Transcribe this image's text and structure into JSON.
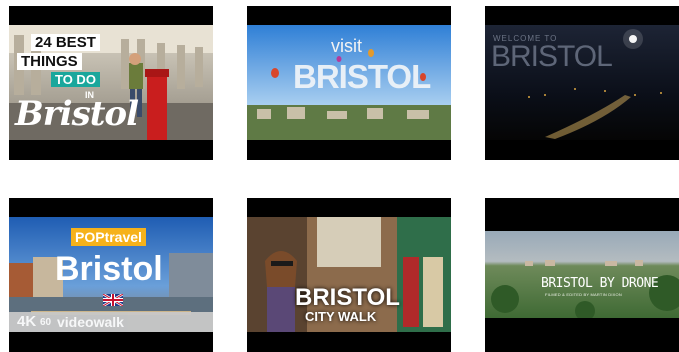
{
  "videos": [
    {
      "top_label": "24 BEST",
      "mid_label": "THINGS",
      "highlight": "TO DO",
      "small": "IN",
      "script_title": "Bristol"
    },
    {
      "small": "visit",
      "title": "BRISTOL"
    },
    {
      "small": "WELCOME TO",
      "title": "BRISTOL"
    },
    {
      "brand": "POPtravel",
      "title": "Bristol",
      "quality": "4K",
      "fps": "60",
      "label": "videowalk"
    },
    {
      "title": "BRISTOL",
      "subtitle": "CITY WALK"
    },
    {
      "title": "BRISTOL BY DRONE",
      "credit": "FILMED & EDITED BY MARTIN DIXON"
    }
  ],
  "colors": {
    "letterbox": "#000000",
    "teal_highlight": "#1aa79c",
    "pop_yellow": "#f6b21b",
    "page": "#ffffff"
  }
}
